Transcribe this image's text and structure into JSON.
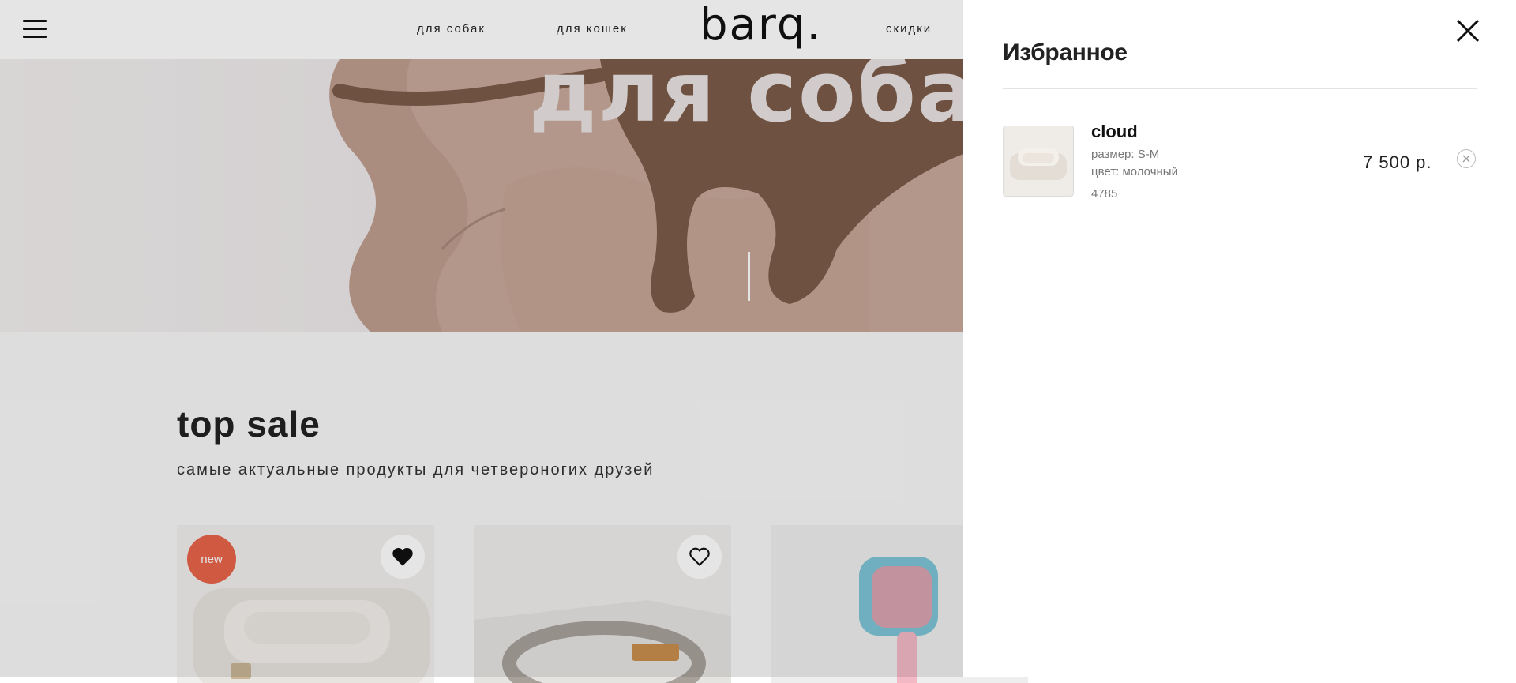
{
  "header": {
    "nav": [
      {
        "label": "для собак"
      },
      {
        "label": "для кошек"
      },
      {
        "label": "скидки"
      }
    ],
    "logo": "barq."
  },
  "hero": {
    "title": "для собак"
  },
  "top_sale": {
    "title": "top sale",
    "subtitle": "самые актуальные продукты для четвероногих друзей",
    "cards": [
      {
        "badge": "new",
        "favorited": true
      },
      {
        "favorited": false
      },
      {
        "favorited": false
      }
    ]
  },
  "favorites": {
    "title": "Избранное",
    "items": [
      {
        "name": "cloud",
        "size": "размер: S-M",
        "color": "цвет: молочный",
        "code": "4785",
        "price": "7 500  р."
      }
    ]
  },
  "colors": {
    "badge_new": "#e8644a",
    "hero_bed": "#c8a79a",
    "dog": "#7a5a48"
  }
}
